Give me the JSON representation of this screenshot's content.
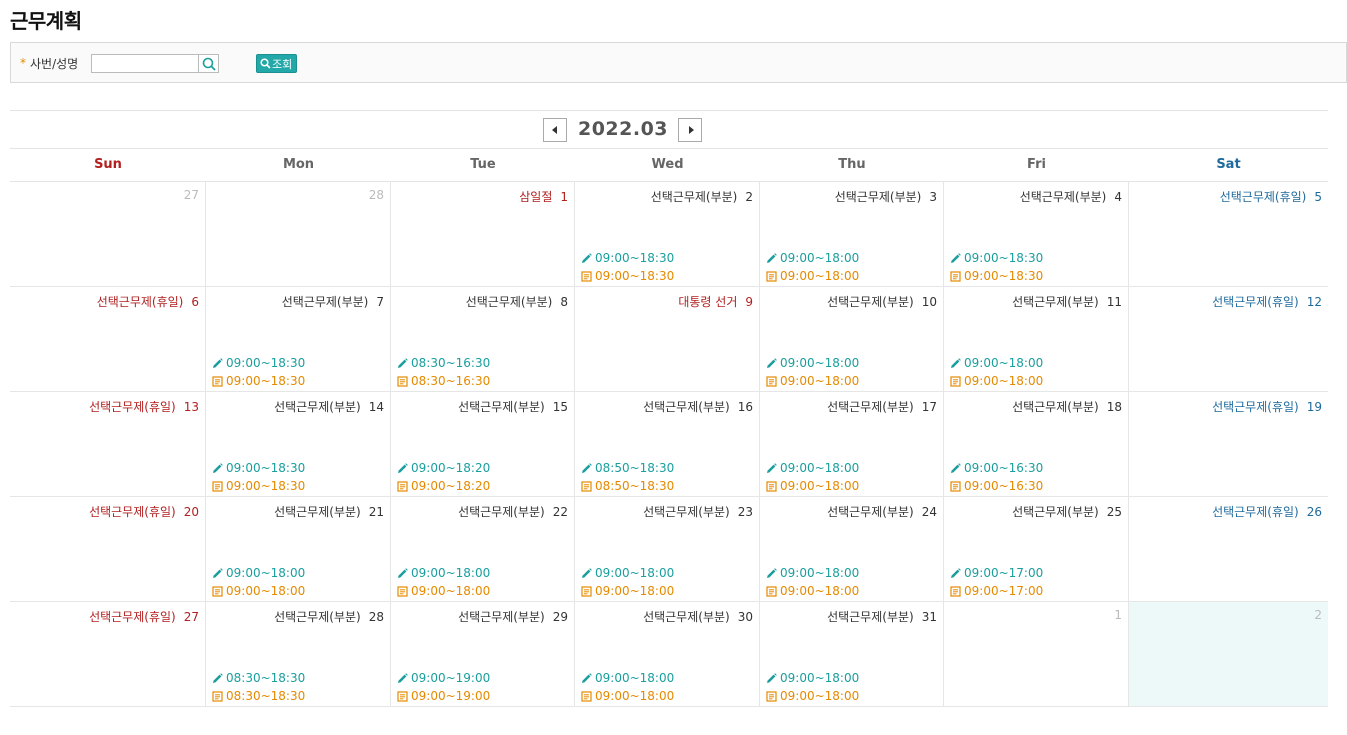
{
  "page": {
    "title": "근무계획"
  },
  "search": {
    "label": "사번/성명",
    "required_mark": "*",
    "value": "",
    "query_button": "조회"
  },
  "calendar": {
    "month_label": "2022.03",
    "weekdays": [
      "Sun",
      "Mon",
      "Tue",
      "Wed",
      "Thu",
      "Fri",
      "Sat"
    ],
    "weeks": [
      [
        {
          "day": "27",
          "label": "",
          "kind": "other"
        },
        {
          "day": "28",
          "label": "",
          "kind": "other"
        },
        {
          "day": "1",
          "label": "삼일절",
          "kind": "holiday"
        },
        {
          "day": "2",
          "label": "선택근무제(부분)",
          "kind": "normal",
          "plan": "09:00~18:30",
          "actual": "09:00~18:30"
        },
        {
          "day": "3",
          "label": "선택근무제(부분)",
          "kind": "normal",
          "plan": "09:00~18:00",
          "actual": "09:00~18:00"
        },
        {
          "day": "4",
          "label": "선택근무제(부분)",
          "kind": "normal",
          "plan": "09:00~18:30",
          "actual": "09:00~18:30"
        },
        {
          "day": "5",
          "label": "선택근무제(휴일)",
          "kind": "sat"
        }
      ],
      [
        {
          "day": "6",
          "label": "선택근무제(휴일)",
          "kind": "holiday"
        },
        {
          "day": "7",
          "label": "선택근무제(부분)",
          "kind": "normal",
          "plan": "09:00~18:30",
          "actual": "09:00~18:30"
        },
        {
          "day": "8",
          "label": "선택근무제(부분)",
          "kind": "normal",
          "plan": "08:30~16:30",
          "actual": "08:30~16:30"
        },
        {
          "day": "9",
          "label": "대통령 선거",
          "kind": "holiday"
        },
        {
          "day": "10",
          "label": "선택근무제(부분)",
          "kind": "normal",
          "plan": "09:00~18:00",
          "actual": "09:00~18:00"
        },
        {
          "day": "11",
          "label": "선택근무제(부분)",
          "kind": "normal",
          "plan": "09:00~18:00",
          "actual": "09:00~18:00"
        },
        {
          "day": "12",
          "label": "선택근무제(휴일)",
          "kind": "sat"
        }
      ],
      [
        {
          "day": "13",
          "label": "선택근무제(휴일)",
          "kind": "holiday"
        },
        {
          "day": "14",
          "label": "선택근무제(부분)",
          "kind": "normal",
          "plan": "09:00~18:30",
          "actual": "09:00~18:30"
        },
        {
          "day": "15",
          "label": "선택근무제(부분)",
          "kind": "normal",
          "plan": "09:00~18:20",
          "actual": "09:00~18:20"
        },
        {
          "day": "16",
          "label": "선택근무제(부분)",
          "kind": "normal",
          "plan": "08:50~18:30",
          "actual": "08:50~18:30"
        },
        {
          "day": "17",
          "label": "선택근무제(부분)",
          "kind": "normal",
          "plan": "09:00~18:00",
          "actual": "09:00~18:00"
        },
        {
          "day": "18",
          "label": "선택근무제(부분)",
          "kind": "normal",
          "plan": "09:00~16:30",
          "actual": "09:00~16:30"
        },
        {
          "day": "19",
          "label": "선택근무제(휴일)",
          "kind": "sat"
        }
      ],
      [
        {
          "day": "20",
          "label": "선택근무제(휴일)",
          "kind": "holiday"
        },
        {
          "day": "21",
          "label": "선택근무제(부분)",
          "kind": "normal",
          "plan": "09:00~18:00",
          "actual": "09:00~18:00"
        },
        {
          "day": "22",
          "label": "선택근무제(부분)",
          "kind": "normal",
          "plan": "09:00~18:00",
          "actual": "09:00~18:00"
        },
        {
          "day": "23",
          "label": "선택근무제(부분)",
          "kind": "normal",
          "plan": "09:00~18:00",
          "actual": "09:00~18:00"
        },
        {
          "day": "24",
          "label": "선택근무제(부분)",
          "kind": "normal",
          "plan": "09:00~18:00",
          "actual": "09:00~18:00"
        },
        {
          "day": "25",
          "label": "선택근무제(부분)",
          "kind": "normal",
          "plan": "09:00~17:00",
          "actual": "09:00~17:00"
        },
        {
          "day": "26",
          "label": "선택근무제(휴일)",
          "kind": "sat"
        }
      ],
      [
        {
          "day": "27",
          "label": "선택근무제(휴일)",
          "kind": "holiday"
        },
        {
          "day": "28",
          "label": "선택근무제(부분)",
          "kind": "normal",
          "plan": "08:30~18:30",
          "actual": "08:30~18:30"
        },
        {
          "day": "29",
          "label": "선택근무제(부분)",
          "kind": "normal",
          "plan": "09:00~19:00",
          "actual": "09:00~19:00"
        },
        {
          "day": "30",
          "label": "선택근무제(부분)",
          "kind": "normal",
          "plan": "09:00~18:00",
          "actual": "09:00~18:00"
        },
        {
          "day": "31",
          "label": "선택근무제(부분)",
          "kind": "normal",
          "plan": "09:00~18:00",
          "actual": "09:00~18:00"
        },
        {
          "day": "1",
          "label": "",
          "kind": "other"
        },
        {
          "day": "2",
          "label": "",
          "kind": "other",
          "today": true
        }
      ]
    ]
  },
  "colors": {
    "accent": "#22a8a8",
    "plan": "#1a9e9e",
    "actual": "#e58a00",
    "holiday": "#b22020",
    "saturday": "#1f6a9c",
    "today_bg": "#ecf9f8"
  },
  "icons": {
    "plan": "pencil-icon",
    "actual": "document-icon",
    "search": "search-icon",
    "prev": "caret-left-icon",
    "next": "caret-right-icon"
  }
}
